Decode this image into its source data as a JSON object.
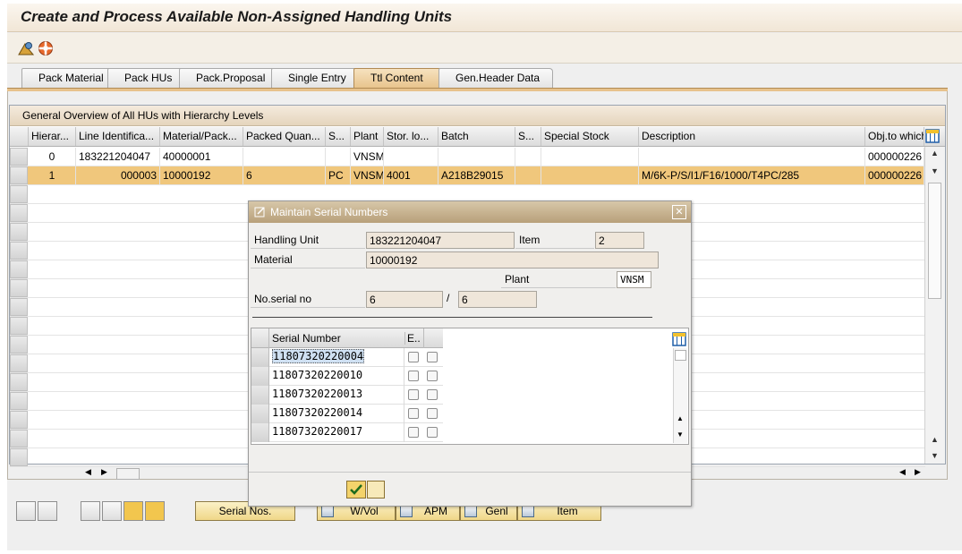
{
  "window": {
    "title": "Create and Process Available Non-Assigned Handling Units"
  },
  "toolbar": {
    "icons": [
      "overview-icon",
      "help-lifebuoy-icon"
    ]
  },
  "tabs": [
    {
      "label": "Pack Material"
    },
    {
      "label": "Pack HUs"
    },
    {
      "label": "Pack.Proposal"
    },
    {
      "label": "Single Entry"
    },
    {
      "label": "Ttl Content",
      "active": true
    },
    {
      "label": "Gen.Header Data"
    }
  ],
  "grid": {
    "title": "General Overview of All HUs with Hierarchy Levels",
    "columns": [
      "Hierar...",
      "Line Identifica...",
      "Material/Pack...",
      "Packed Quan...",
      "S...",
      "Plant",
      "Stor. lo...",
      "Batch",
      "S...",
      "Special Stock",
      "Description",
      "Obj.to which"
    ],
    "rows": [
      [
        "0",
        "183221204047",
        "40000001",
        "",
        "",
        "VNSM",
        "",
        "",
        "",
        "",
        "",
        "000000226"
      ],
      [
        "1",
        "000003",
        "10000192",
        "6",
        "PC",
        "VNSM",
        "4001",
        "A218B29015",
        "",
        "",
        "M/6K-P/S/I1/F16/1000/T4PC/285",
        "000000226"
      ]
    ]
  },
  "bottom_toolbar": {
    "serial_nos": "Serial Nos.",
    "wvol": "W/Vol",
    "apm": "APM",
    "genl": "Genl",
    "item": "Item"
  },
  "dialog": {
    "title": "Maintain Serial Numbers",
    "handling_unit_label": "Handling Unit",
    "handling_unit_value": "183221204047",
    "item_label": "Item",
    "item_value": "2",
    "material_label": "Material",
    "material_value": "10000192",
    "plant_label": "Plant",
    "plant_value": "VNSM",
    "no_serial_label": "No.serial no",
    "no_serial_value": "6",
    "no_serial_sep": "/",
    "no_serial_total": "6",
    "serial_table": {
      "col_serial": "Serial Number",
      "col_e": "E..",
      "rows": [
        "11807320220004",
        "11807320220010",
        "11807320220013",
        "11807320220014",
        "11807320220017"
      ]
    }
  }
}
